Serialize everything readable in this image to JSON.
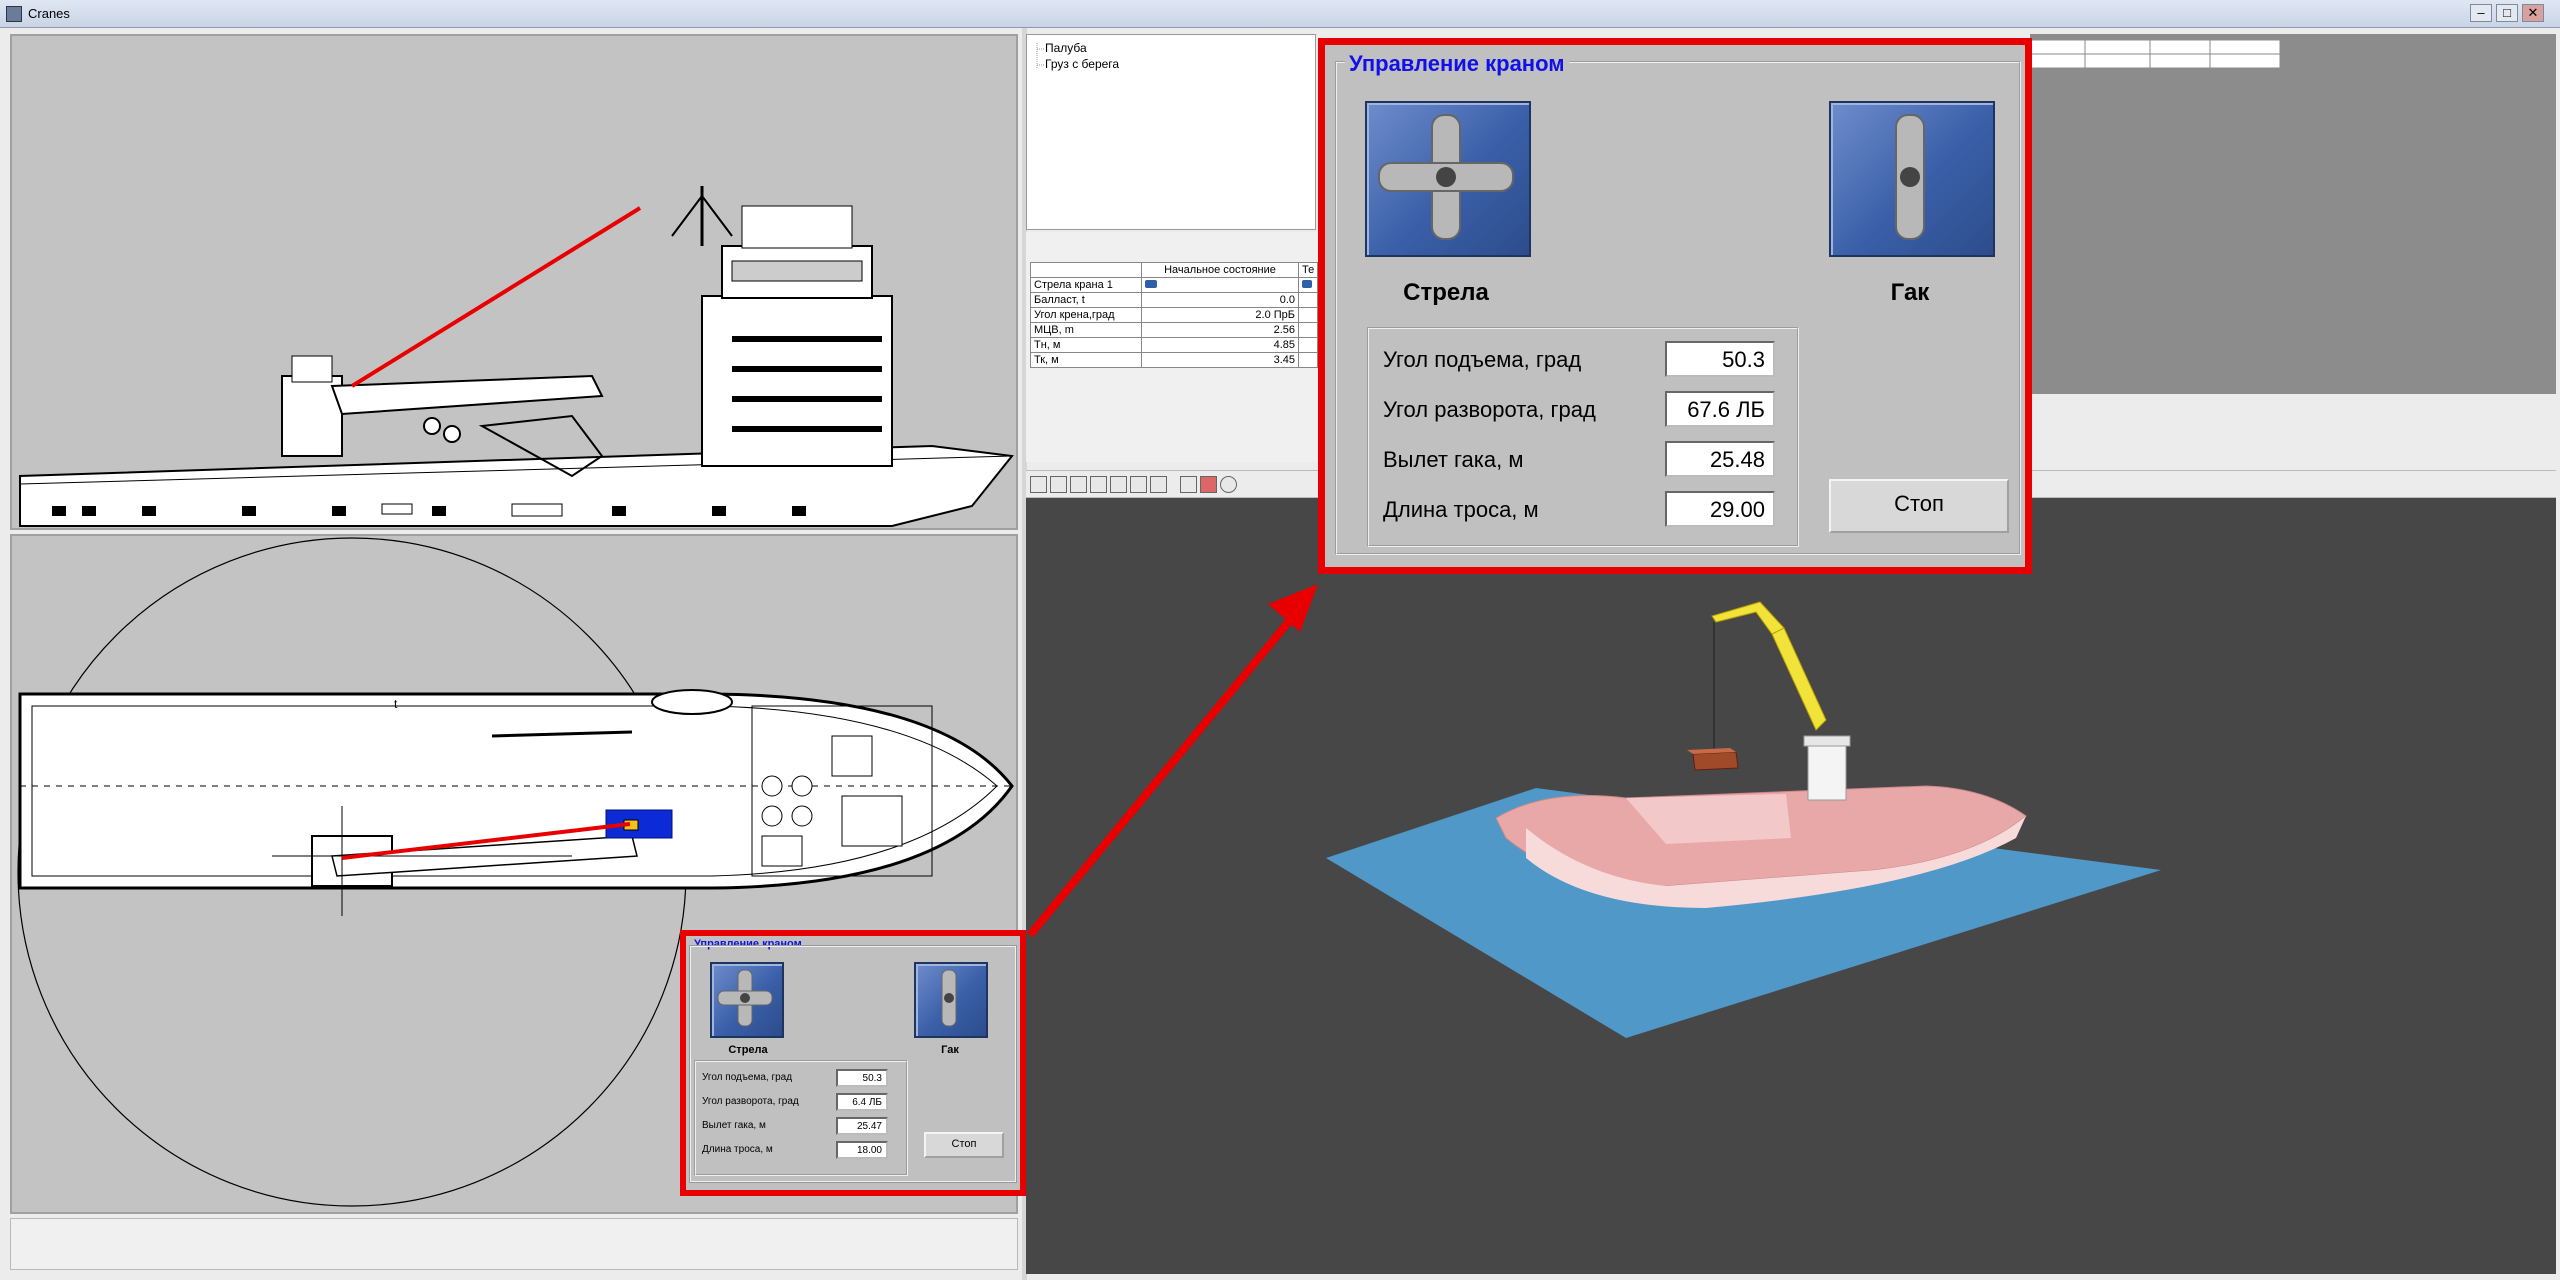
{
  "window": {
    "title": "Cranes",
    "minimize": "–",
    "maximize": "□",
    "close": "✕"
  },
  "tree": {
    "items": [
      "Палуба",
      "Груз с берега"
    ]
  },
  "params_table": {
    "headers": [
      "",
      "Начальное состояние",
      "Те"
    ],
    "rows": [
      [
        "Стрела крана 1",
        "",
        ""
      ],
      [
        "Балласт, t",
        "0.0",
        ""
      ],
      [
        "Угол крена,град",
        "2.0  ПрБ",
        ""
      ],
      [
        "МЦВ, m",
        "2.56",
        ""
      ],
      [
        "Тн, м",
        "4.85",
        ""
      ],
      [
        "Тк, м",
        "3.45",
        ""
      ]
    ]
  },
  "top_view": {
    "deck_marker": "t"
  },
  "control_big": {
    "legend": "Управление краном",
    "boom_label": "Стрела",
    "hook_label": "Гак",
    "rows": [
      {
        "label": "Угол подъема, град",
        "value": "50.3"
      },
      {
        "label": "Угол разворота, град",
        "value": "67.6 ЛБ"
      },
      {
        "label": "Вылет гака, м",
        "value": "25.48"
      },
      {
        "label": "Длина троса, м",
        "value": "29.00"
      }
    ],
    "stop_label": "Стоп"
  },
  "control_small": {
    "legend": "Управление краном",
    "boom_label": "Стрела",
    "hook_label": "Гак",
    "rows": [
      {
        "label": "Угол подъема, град",
        "value": "50.3"
      },
      {
        "label": "Угол разворота, град",
        "value": "6.4 ЛБ"
      },
      {
        "label": "Вылет гака, м",
        "value": "25.47"
      },
      {
        "label": "Длина троса, м",
        "value": "18.00"
      }
    ],
    "stop_label": "Стоп"
  },
  "colors": {
    "highlight": "#e80000",
    "legend": "#1010e8",
    "joystick": "#3a5fa8",
    "hull": "#e8a8a8",
    "crane": "#f2e33a",
    "water": "#4f98c8",
    "viewport": "#474747"
  }
}
